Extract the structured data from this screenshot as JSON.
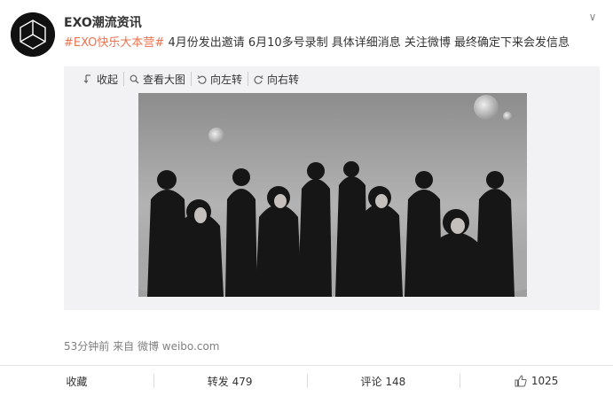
{
  "post": {
    "username": "EXO潮流资讯",
    "topic": "#EXO快乐大本营#",
    "text": " 4月份发出邀请 6月10多号录制 具体详细消息 关注微博 最终确定下来会发信息"
  },
  "media_toolbar": {
    "collapse_label": "收起",
    "view_large_label": "查看大图",
    "rotate_left_label": "向左转",
    "rotate_right_label": "向右转"
  },
  "meta": {
    "time": "53分钟前",
    "from_label": "来自",
    "source": "微博 weibo.com"
  },
  "actions": {
    "favorite_label": "收藏",
    "repost_label": "转发 479",
    "comment_label": "评论 148",
    "like_count": "1025"
  },
  "icons": {
    "menu": "chevron-down-icon",
    "collapse": "collapse-icon",
    "view_large": "search-icon",
    "rotate_left": "rotate-left-icon",
    "rotate_right": "rotate-right-icon",
    "like": "thumbs-up-icon"
  },
  "colors": {
    "topic": "#eb7350",
    "media_background": "#f2f2f5",
    "meta_text": "#808080"
  }
}
